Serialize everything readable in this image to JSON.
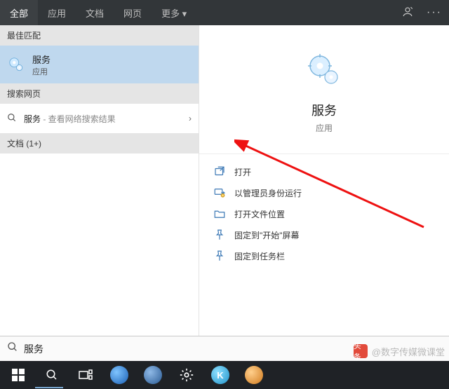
{
  "colors": {
    "accent": "#4a90d9",
    "taskbar": "#1f2226",
    "tab_bg": "#323639",
    "best_match_bg": "#bfd8ee"
  },
  "tabs": {
    "items": [
      {
        "label": "全部"
      },
      {
        "label": "应用"
      },
      {
        "label": "文档"
      },
      {
        "label": "网页"
      },
      {
        "label": "更多 ▾"
      }
    ],
    "active_index": 0
  },
  "left": {
    "best_match_header": "最佳匹配",
    "best_match": {
      "title": "服务",
      "subtitle": "应用"
    },
    "search_web_header": "搜索网页",
    "web_item": {
      "term": "服务",
      "hint": " - 查看网络搜索结果"
    },
    "docs_header": "文档 (1+)"
  },
  "right": {
    "title": "服务",
    "kind": "应用",
    "actions": [
      {
        "icon": "open",
        "label": "打开"
      },
      {
        "icon": "admin",
        "label": "以管理员身份运行"
      },
      {
        "icon": "folder",
        "label": "打开文件位置"
      },
      {
        "icon": "pin-start",
        "label": "固定到\"开始\"屏幕"
      },
      {
        "icon": "pin-taskbar",
        "label": "固定到任务栏"
      }
    ]
  },
  "search": {
    "placeholder": "",
    "value": "服务"
  },
  "watermark": {
    "brand": "头条",
    "text": "@数字传媒微课堂"
  },
  "taskbar": {
    "apps": [
      {
        "name": "sogou",
        "color": "#2a7de1"
      },
      {
        "name": "globe",
        "color": "#2a6db0"
      },
      {
        "name": "settings",
        "color": "#7b7b7b"
      },
      {
        "name": "konqueror",
        "color": "#3fb3e6"
      },
      {
        "name": "weibo",
        "color": "#e38b2b"
      }
    ]
  }
}
